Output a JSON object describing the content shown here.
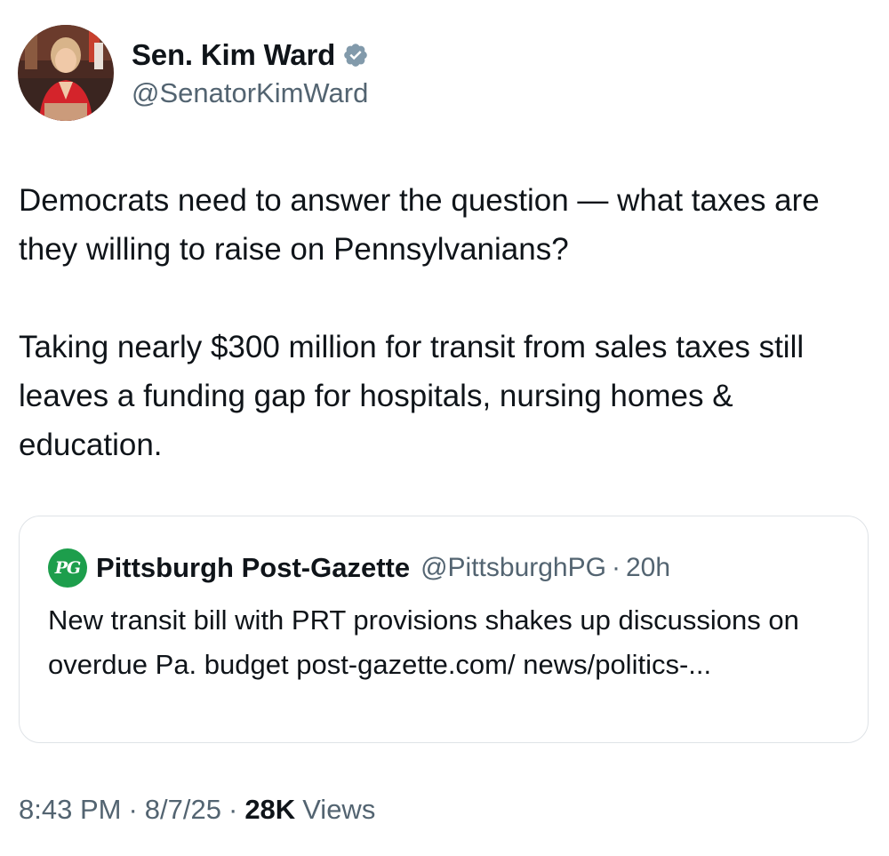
{
  "author": {
    "display_name": "Sen. Kim Ward",
    "handle": "@SenatorKimWard",
    "verified_icon": "verified-badge-icon",
    "avatar_icon": "profile-photo"
  },
  "tweet": {
    "paragraphs": [
      "Democrats need to answer the question — what taxes are they willing to raise on Pennsylvanians?",
      "Taking nearly $300 million for transit from sales taxes still leaves a funding gap for hospitals, nursing homes & education."
    ]
  },
  "quoted_tweet": {
    "logo_text": "PG",
    "display_name": "Pittsburgh Post-Gazette",
    "handle": "@PittsburghPG",
    "separator": "·",
    "time": "20h",
    "text": "New transit bill with PRT provisions shakes up discussions on overdue Pa. budget post-gazette.com/ news/politics-..."
  },
  "meta": {
    "time": "8:43 PM",
    "separator": "·",
    "date": "8/7/25",
    "views_count": "28K",
    "views_label": "Views"
  },
  "colors": {
    "text_primary": "#0f1419",
    "text_secondary": "#536471",
    "verified_blue": "#1d9bf0",
    "pg_green": "#1d9e4c",
    "card_border": "#dfe3e7"
  }
}
